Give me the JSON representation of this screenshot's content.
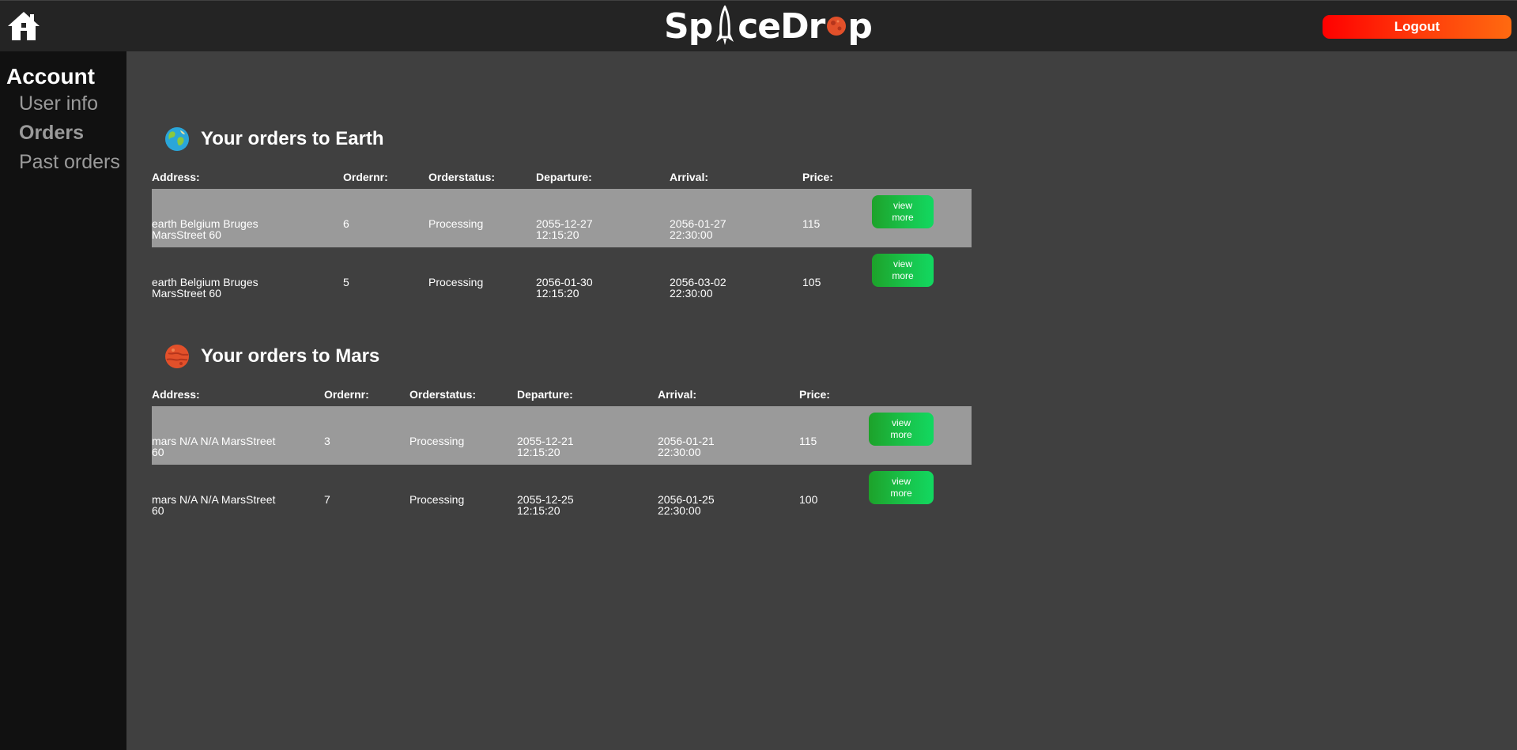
{
  "header": {
    "logo_text_pre": "Sp",
    "logo_text_mid": "ceDr",
    "logo_text_post": "p",
    "logout_label": "Logout",
    "home_icon": "home-icon",
    "colors": {
      "header_bg": "#242424",
      "logout_gradient": [
        "#ff0000",
        "#ff6a10"
      ]
    }
  },
  "sidebar": {
    "title": "Account",
    "items": [
      {
        "label": "User info",
        "active": false
      },
      {
        "label": "Orders",
        "active": true
      },
      {
        "label": "Past orders",
        "active": false
      }
    ]
  },
  "earth": {
    "title": "Your orders to Earth",
    "icon": "earth-icon",
    "headers": [
      "Address:",
      "Ordernr:",
      "Orderstatus:",
      "Departure:",
      "Arrival:",
      "Price:"
    ],
    "rows": [
      {
        "address": [
          "earth Belgium Bruges",
          "MarsStreet 60"
        ],
        "ordernr": "6",
        "status": "Processing",
        "departure": [
          "2055-12-27",
          "12:15:20"
        ],
        "arrival": [
          "2056-01-27",
          "22:30:00"
        ],
        "price": "115",
        "button": [
          "view",
          "more"
        ]
      },
      {
        "address": [
          "earth Belgium Bruges",
          "MarsStreet 60"
        ],
        "ordernr": "5",
        "status": "Processing",
        "departure": [
          "2056-01-30",
          "12:15:20"
        ],
        "arrival": [
          "2056-03-02",
          "22:30:00"
        ],
        "price": "105",
        "button": [
          "view",
          "more"
        ]
      }
    ]
  },
  "mars": {
    "title": "Your orders to Mars",
    "icon": "mars-icon",
    "headers": [
      "Address:",
      "Ordernr:",
      "Orderstatus:",
      "Departure:",
      "Arrival:",
      "Price:"
    ],
    "rows": [
      {
        "address": [
          "mars N/A N/A MarsStreet",
          "60"
        ],
        "ordernr": "3",
        "status": "Processing",
        "departure": [
          "2055-12-21",
          "12:15:20"
        ],
        "arrival": [
          "2056-01-21",
          "22:30:00"
        ],
        "price": "115",
        "button": [
          "view",
          "more"
        ]
      },
      {
        "address": [
          "mars N/A N/A MarsStreet",
          "60"
        ],
        "ordernr": "7",
        "status": "Processing",
        "departure": [
          "2055-12-25",
          "12:15:20"
        ],
        "arrival": [
          "2056-01-25",
          "22:30:00"
        ],
        "price": "100",
        "button": [
          "view",
          "more"
        ]
      }
    ]
  },
  "colors": {
    "page_bg": "#404040",
    "sidebar_bg": "#111111",
    "row_shade": "#9a9a9a",
    "view_button": "#19c24a"
  }
}
